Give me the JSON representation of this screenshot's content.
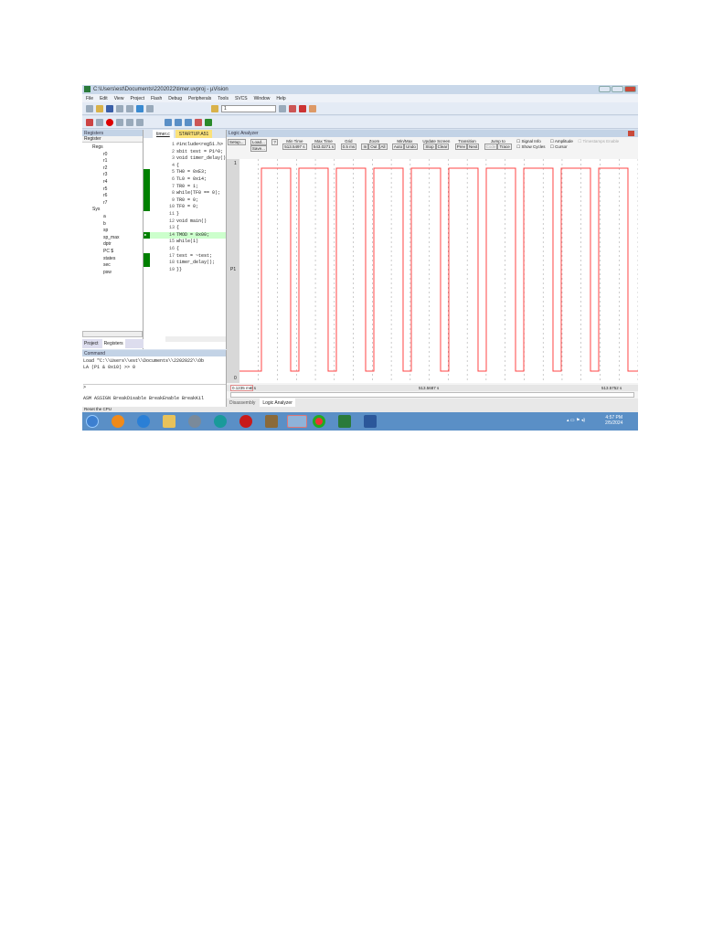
{
  "window": {
    "title": "C:\\Users\\est\\Documents\\2202022\\timer.uvproj - µVision"
  },
  "menu": [
    "File",
    "Edit",
    "View",
    "Project",
    "Flash",
    "Debug",
    "Peripherals",
    "Tools",
    "SVCS",
    "Window",
    "Help"
  ],
  "toolbar": {
    "target_value": "1"
  },
  "registers": {
    "title": "Registers",
    "header": "Register",
    "groups": [
      {
        "name": "Regs",
        "items": [
          "r0",
          "r1",
          "r2",
          "r3",
          "r4",
          "r5",
          "r6",
          "r7"
        ]
      },
      {
        "name": "Sys",
        "items": [
          "a",
          "b",
          "sp",
          "sp_max",
          "dptr",
          "PC $",
          "states",
          "sec",
          "psw"
        ]
      }
    ],
    "tabs": [
      "Project",
      "Registers"
    ]
  },
  "editor": {
    "tabs": [
      "timer.c",
      "STARTUP.A51"
    ],
    "lines": [
      "#include<reg51.h>",
      "sbit test = P1^0;",
      "void timer_delay()",
      "{",
      "TH0 = 0xE3;",
      "TL0 = 0x14;",
      "TR0 = 1;",
      "while(TF0 == 0);",
      "TR0 = 0;",
      "TF0 = 0;",
      "}",
      "void main()",
      "{",
      "TMOD = 0x00;",
      "while(1)",
      "{",
      "test = ~test;",
      "timer_delay();",
      "}}"
    ],
    "current_line": 14
  },
  "command": {
    "title": "Command",
    "output": [
      "Load \"C:\\\\Users\\\\est\\\\Documents\\\\2202022\\\\Ob",
      "LA (P1 & 0x10) >> 0"
    ],
    "prompt": ">",
    "autocomplete": "ASM ASSIGN BreakDisable BreakEnable BreakKil"
  },
  "logic_analyzer": {
    "title": "Logic Analyzer",
    "setup": "Setup...",
    "load": "Load...",
    "save": "Save...",
    "help": "?",
    "min_time_label": "Min Time",
    "min_time": "513.5497 s",
    "max_time_label": "Max Time",
    "max_time": "543.0271 s",
    "grid_label": "Grid",
    "grid": "0.5 ms",
    "zoom_label": "Zoom",
    "zoom_buttons": [
      "In",
      "Out",
      "All"
    ],
    "minmax_label": "Min/Max",
    "minmax_buttons": [
      "Auto",
      "Undo"
    ],
    "update_label": "Update Screen",
    "update_buttons": [
      "Stop",
      "Clear"
    ],
    "transition_label": "Transition",
    "transition_buttons": [
      "Prev",
      "Next"
    ],
    "jump_label": "Jump to",
    "jump_buttons": [
      "Code",
      "Trace"
    ],
    "checks": [
      "Signal Info",
      "Show Cycles",
      "Amplitude",
      "Cursor",
      "Timestamps Enable"
    ],
    "signal": "P1",
    "y_high": "1",
    "y_low": "0",
    "time_delta": "0.1235 ms",
    "time_start": "0 s",
    "time_mid": "513.5687 s",
    "time_end": "513.5752 s",
    "waveform": {
      "periods": 10,
      "duty_high": 0.78,
      "start_offset": 0.27
    }
  },
  "bottom_tabs": [
    "Disassembly",
    "Logic Analyzer"
  ],
  "status": "Reset the CPU",
  "clock": {
    "time": "4:57 PM",
    "date": "2/5/2024"
  },
  "colors": {
    "wave": "#ff4444",
    "current_line": "#ccffcc",
    "coverage": "#008000"
  }
}
